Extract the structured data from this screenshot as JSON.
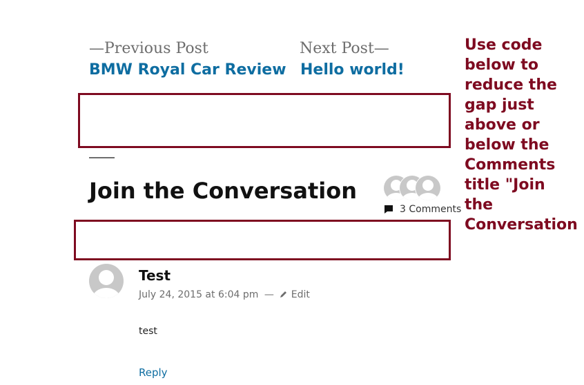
{
  "post_navigation": {
    "previous": {
      "meta": "—Previous Post",
      "title": "BMW Royal Car Review"
    },
    "next": {
      "meta": "Next Post—",
      "title": "Hello world!"
    }
  },
  "comments_header": {
    "title": "Join the Conversation",
    "count_label": "3 Comments",
    "avatar_count": 3
  },
  "annotation": {
    "lines": [
      "Use code",
      "below to",
      "reduce the",
      "gap just",
      "above or",
      "below the",
      "Comments",
      "title \"Join",
      "the",
      "Conversation"
    ],
    "color": "#7e0a20"
  },
  "comment": {
    "author": "Test",
    "date": "July 24, 2015 at 6:04 pm",
    "separator": "—",
    "edit_label": "Edit",
    "text": "test",
    "reply_label": "Reply"
  },
  "colors": {
    "link": "#0e6da1",
    "meta": "#6d6d6d",
    "highlight": "#7e0a20"
  }
}
